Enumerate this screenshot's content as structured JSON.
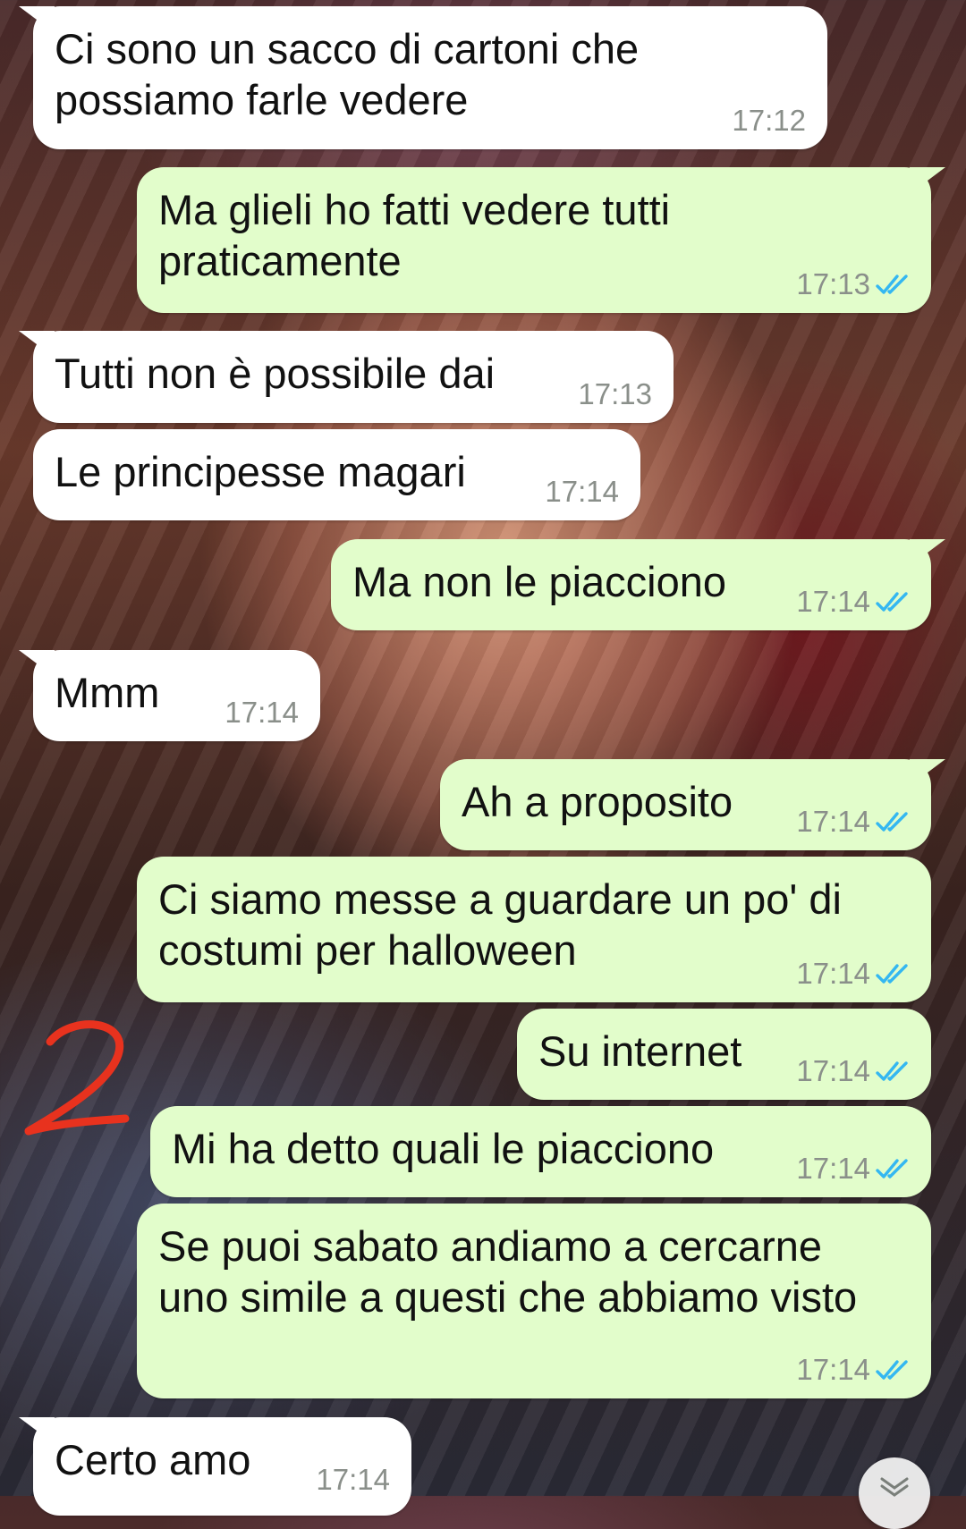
{
  "colors": {
    "incoming_bubble": "#ffffff",
    "outgoing_bubble": "#e2fdcb",
    "read_ticks": "#34b7f1",
    "annotation": "#e8321e"
  },
  "annotation": {
    "label": "2"
  },
  "messages": [
    {
      "direction": "in",
      "text": "Ci sono un sacco di cartoni che\npossiamo farle vedere",
      "time": "17:12"
    },
    {
      "direction": "out",
      "text": "Ma glieli ho fatti vedere tutti\npraticamente",
      "time": "17:13",
      "status": "read"
    },
    {
      "direction": "in",
      "text": "Tutti non è possibile dai",
      "time": "17:13"
    },
    {
      "direction": "in",
      "text": "Le principesse magari",
      "time": "17:14"
    },
    {
      "direction": "out",
      "text": "Ma non le piacciono",
      "time": "17:14",
      "status": "read"
    },
    {
      "direction": "in",
      "text": "Mmm",
      "time": "17:14"
    },
    {
      "direction": "out",
      "text": "Ah a proposito",
      "time": "17:14",
      "status": "read"
    },
    {
      "direction": "out",
      "text": "Ci siamo messe a guardare un po' di\ncostumi per halloween",
      "time": "17:14",
      "status": "read"
    },
    {
      "direction": "out",
      "text": "Su internet",
      "time": "17:14",
      "status": "read"
    },
    {
      "direction": "out",
      "text": "Mi ha detto quali le piacciono",
      "time": "17:14",
      "status": "read"
    },
    {
      "direction": "out",
      "text": "Se puoi sabato andiamo a cercarne\nuno simile a questi che abbiamo visto",
      "time": "17:14",
      "status": "read"
    },
    {
      "direction": "in",
      "text": "Certo amo",
      "time": "17:14"
    }
  ],
  "scroll_button": {
    "icon": "double-chevron-down-icon"
  }
}
